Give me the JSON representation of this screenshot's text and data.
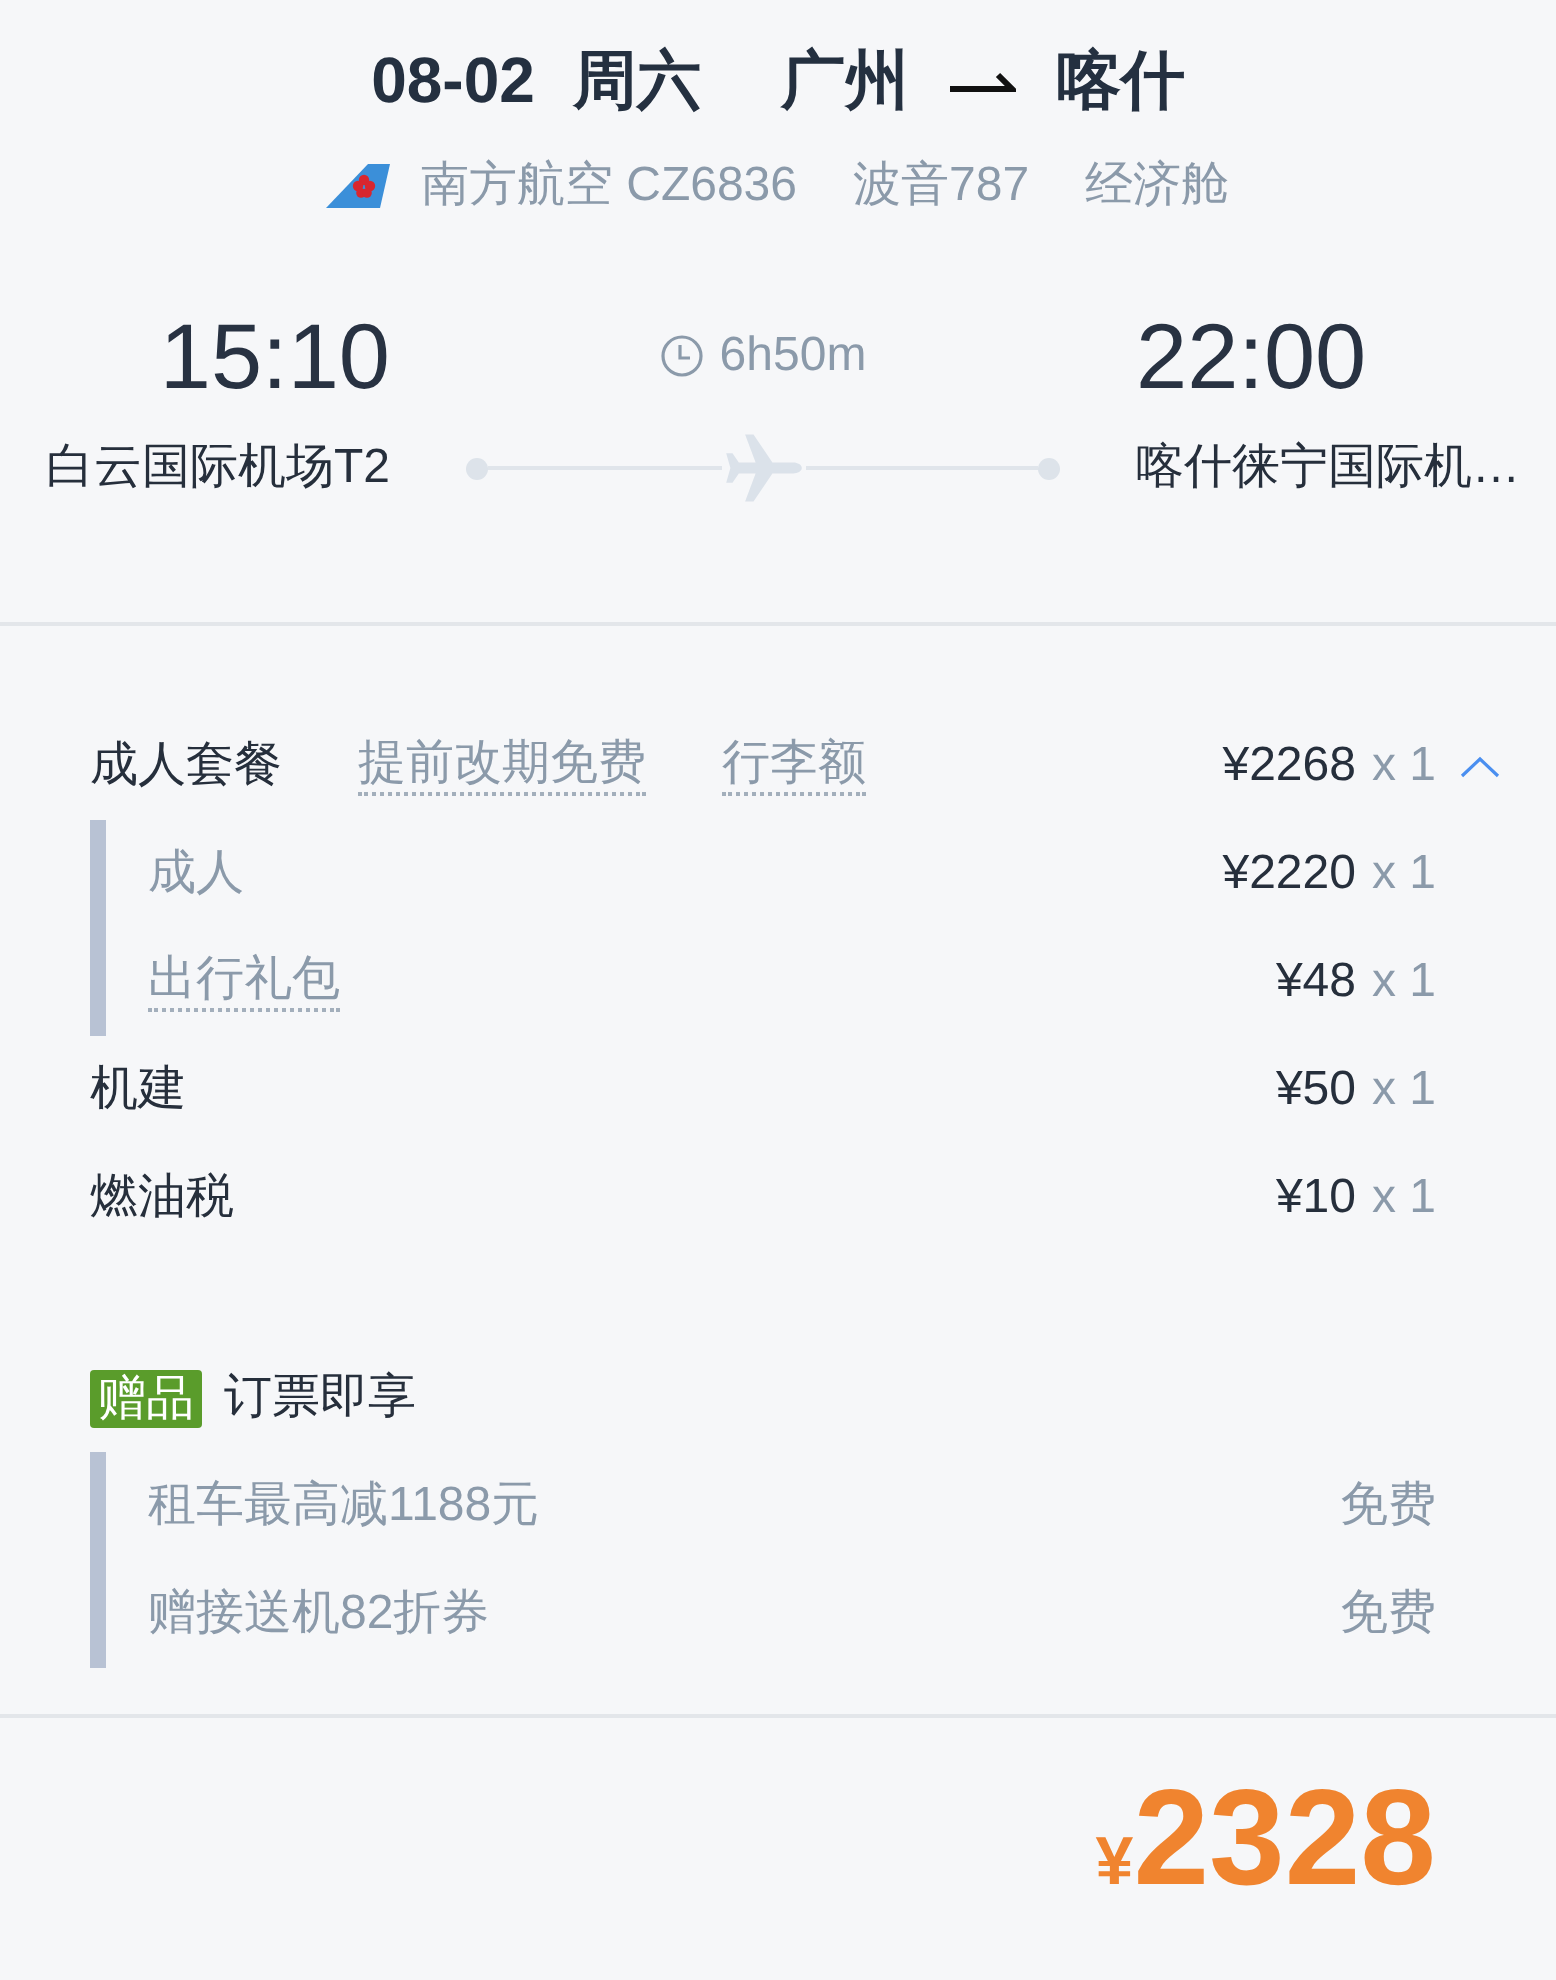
{
  "header": {
    "date": "08-02",
    "weekday": "周六",
    "origin": "广州",
    "destination": "喀什"
  },
  "flight": {
    "airline": "南方航空 CZ6836",
    "aircraft": "波音787",
    "cabin": "经济舱"
  },
  "departure": {
    "time": "15:10",
    "airport": "白云国际机场T2"
  },
  "duration": "6h50m",
  "arrival": {
    "time": "22:00",
    "airport": "喀什徕宁国际机…"
  },
  "package": {
    "label": "成人套餐",
    "tags": [
      "提前改期免费",
      "行李额"
    ],
    "price": "¥2268",
    "quantity": "x 1",
    "expanded": true,
    "items": [
      {
        "kind": "plain",
        "label": "成人",
        "price": "¥2220",
        "quantity": "x 1"
      },
      {
        "kind": "tip",
        "label": "出行礼包",
        "price": "¥48",
        "quantity": "x 1"
      }
    ]
  },
  "fees": [
    {
      "label": "机建",
      "price": "¥50",
      "quantity": "x 1"
    },
    {
      "label": "燃油税",
      "price": "¥10",
      "quantity": "x 1"
    }
  ],
  "gift": {
    "badge": "赠品",
    "title": "订票即享",
    "items": [
      {
        "label": "租车最高减1188元",
        "price": "免费"
      },
      {
        "label": "赠接送机82折券",
        "price": "免费"
      }
    ]
  },
  "total": {
    "currency": "¥",
    "amount": "2328"
  }
}
